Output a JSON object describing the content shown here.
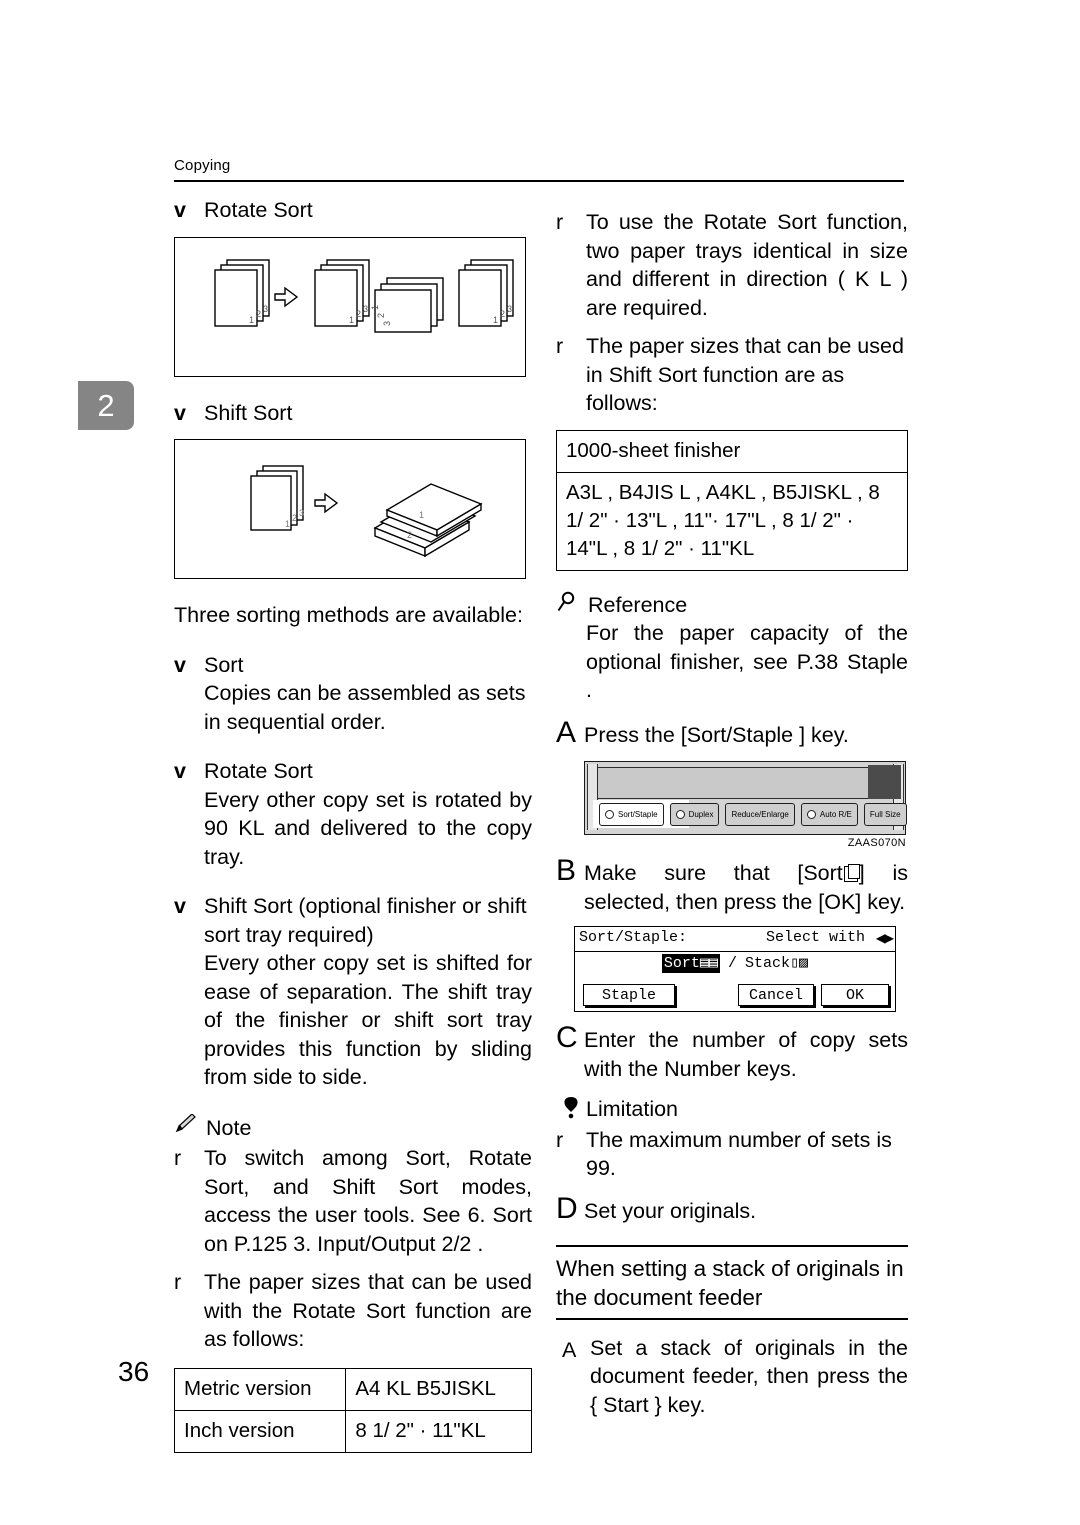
{
  "page": {
    "running_head": "Copying",
    "folio": "36",
    "chapter_tab": "2"
  },
  "left_column": {
    "heading_rotate_sort": "Rotate Sort",
    "heading_shift_sort": "Shift Sort",
    "marker_v": "v",
    "marker_r": "r",
    "fig_rotate_sort_caption": "Rotate Sort illustration: three-page original set copied, every other set rotated 90 degrees",
    "fig_shift_sort_caption": "Shift Sort illustration: three-page original set copied, sets shifted side to side",
    "intro": "Three sorting methods are available:",
    "methods": [
      {
        "title": "Sort",
        "body": "Copies can be assembled as sets in sequential order."
      },
      {
        "title": "Rotate Sort",
        "body": "Every other copy set is rotated by 90 KL and delivered to the copy tray."
      },
      {
        "title": "Shift Sort (optional finisher or shift sort tray required)",
        "body": "Every other copy set is shifted for ease of separation. The shift tray of the finisher or shift sort tray provides this function by sliding from side to side."
      }
    ],
    "note_label": "Note",
    "notes": [
      "To switch among Sort, Rotate Sort, and Shift Sort modes, access the user tools. See 6. Sort on P.125 3. Input/Output 2/2 .",
      "The paper sizes that can be used with the Rotate Sort function are as follows:"
    ],
    "rotate_table": {
      "rows": [
        {
          "label": "Metric version",
          "value": "A4 KL   B5JISKL"
        },
        {
          "label": "Inch version",
          "value": "8 1/ 2\" · 11\"KL"
        }
      ]
    }
  },
  "right_column": {
    "marker_r": "r",
    "notes": [
      "To use the Rotate Sort function, two paper trays identical in size and different in direction ( K  L ) are required.",
      "The paper sizes that can be used in Shift Sort function are as follows:"
    ],
    "finisher_table": {
      "header": "1000-sheet finisher",
      "body": "A3L , B4JIS L , A4KL , B5JISKL , 8 1/ 2\" · 13\"L , 11\"· 17\"L , 8 1/ 2\" · 14\"L , 8 1/ 2\" · 11\"KL"
    },
    "reference_label": "Reference",
    "reference_body": "For the paper capacity of the optional finisher, see P.38 Staple .",
    "steps": [
      {
        "letter": "A",
        "text": "Press the [Sort/Staple ] key."
      },
      {
        "letter": "B",
        "text_before": "Make sure that [Sort",
        "text_after": "] is selected, then press the [OK] key."
      },
      {
        "letter": "C",
        "text": "Enter the number of copy sets with the Number keys."
      },
      {
        "letter": "D",
        "text": "Set your originals."
      }
    ],
    "op_panel": {
      "keys": [
        {
          "label": "Sort/Staple",
          "led": true,
          "selected": true
        },
        {
          "label": "Duplex",
          "led": true,
          "selected": false
        },
        {
          "label": "Reduce/Enlarge",
          "led": false,
          "selected": false
        },
        {
          "label": "Auto R/E",
          "led": true,
          "selected": false
        },
        {
          "label": "Full Size",
          "led": false,
          "selected": false
        }
      ],
      "figure_code": "ZAAS070N"
    },
    "lcd": {
      "title": "Sort/Staple:",
      "select_with": "Select with",
      "arrows": "◀▶",
      "option_sort": "Sort",
      "separator": "/",
      "option_stack": "Stack",
      "btn_staple": "Staple",
      "btn_cancel": "Cancel",
      "btn_ok": "OK"
    },
    "limitation_label": "Limitation",
    "limitation_body": "The maximum number of sets is 99.",
    "subsection_title": "When setting a stack of originals in the document feeder",
    "subsection_step": {
      "letter": "A",
      "text": "Set a stack of originals in the document feeder, then press the { Start } key."
    }
  },
  "colors": {
    "ink": "#000000",
    "paper": "#ffffff",
    "chapter_tab_bg": "#858585",
    "panel_gray": "#d4d4d4"
  }
}
